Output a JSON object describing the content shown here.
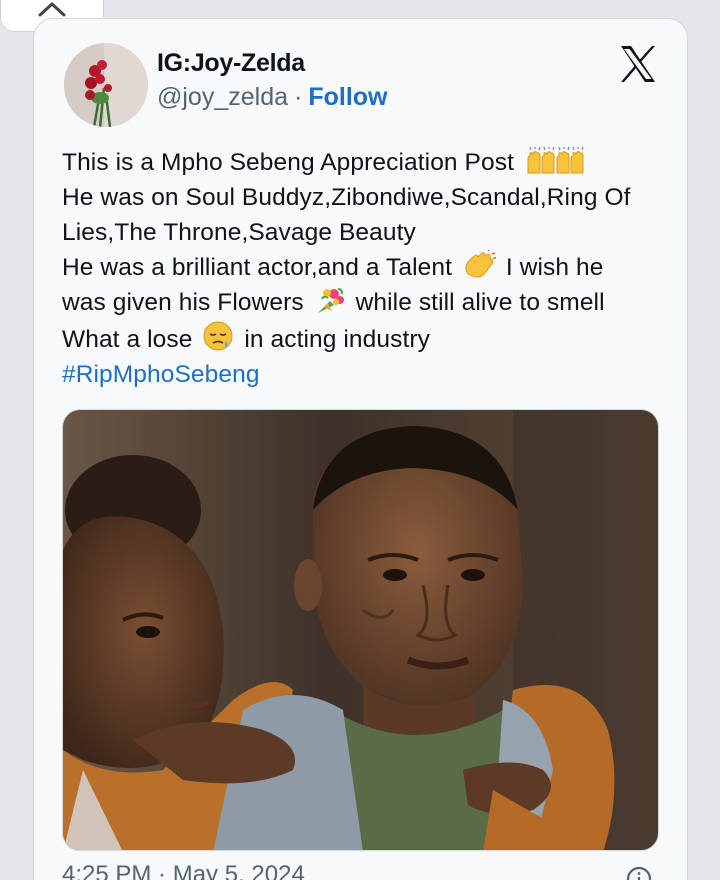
{
  "author": {
    "display_name": "IG:Joy-Zelda",
    "handle": "@joy_zelda",
    "separator": "·",
    "follow_label": "Follow"
  },
  "tweet": {
    "lines": [
      "This is a Mpho Sebeng Appreciation Post",
      "He was on Soul Buddyz,Zibondiwe,Scandal,Ring Of",
      "Lies,The Throne,Savage Beauty",
      "He was a brilliant actor,and a Talent",
      "I wish he",
      "was given his Flowers",
      "while still alive to smell",
      "What a lose",
      "in acting industry"
    ],
    "hashtag": "#RipMphoSebeng"
  },
  "icons": {
    "collapse": "chevron-up-icon",
    "platform": "x-logo-icon",
    "raised_hands": "raised-hands-emoji",
    "clapping": "clapping-hands-emoji",
    "bouquet": "bouquet-emoji",
    "sad": "sad-relieved-face-emoji",
    "info": "info-circle-icon"
  },
  "media": {
    "description_icon": "photo"
  },
  "meta": {
    "timestamp": "4:25 PM · May 5, 2024"
  },
  "colors": {
    "link": "#1d6fc4",
    "secondary_text": "#536471",
    "card_bg": "#f7f9fa"
  }
}
